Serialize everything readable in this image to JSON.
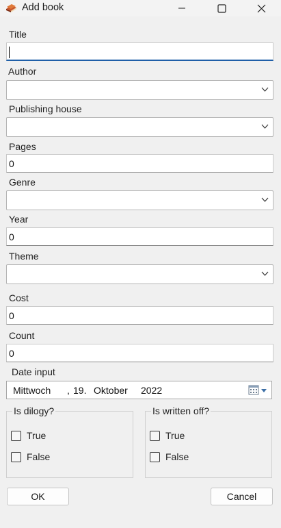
{
  "window": {
    "title": "Add book",
    "icon": "book-icon",
    "controls": [
      "minimize-icon",
      "maximize-icon",
      "close-icon"
    ]
  },
  "form": {
    "title": {
      "label": "Title",
      "value": ""
    },
    "author": {
      "label": "Author",
      "value": ""
    },
    "publishing_house": {
      "label": "Publishing house",
      "value": ""
    },
    "pages": {
      "label": "Pages",
      "value": "0"
    },
    "genre": {
      "label": "Genre",
      "value": ""
    },
    "year": {
      "label": "Year",
      "value": "0"
    },
    "theme": {
      "label": "Theme",
      "value": ""
    },
    "cost": {
      "label": "Cost",
      "value": "0"
    },
    "count": {
      "label": "Count",
      "value": "0"
    },
    "date_input": {
      "label": "Date input",
      "weekday": "Mittwoch",
      "sep": ",",
      "day": "19.",
      "month": "Oktober",
      "year": "2022",
      "icon": "calendar-icon"
    }
  },
  "groups": {
    "dilogy": {
      "label": "Is dilogy?",
      "options": [
        {
          "label": "True",
          "checked": false
        },
        {
          "label": "False",
          "checked": false
        }
      ]
    },
    "written_off": {
      "label": "Is written off?",
      "options": [
        {
          "label": "True",
          "checked": false
        },
        {
          "label": "False",
          "checked": false
        }
      ]
    }
  },
  "buttons": {
    "ok": "OK",
    "cancel": "Cancel"
  },
  "colors": {
    "background": "#f0f0f0",
    "focus_accent": "#1f5fa8"
  }
}
